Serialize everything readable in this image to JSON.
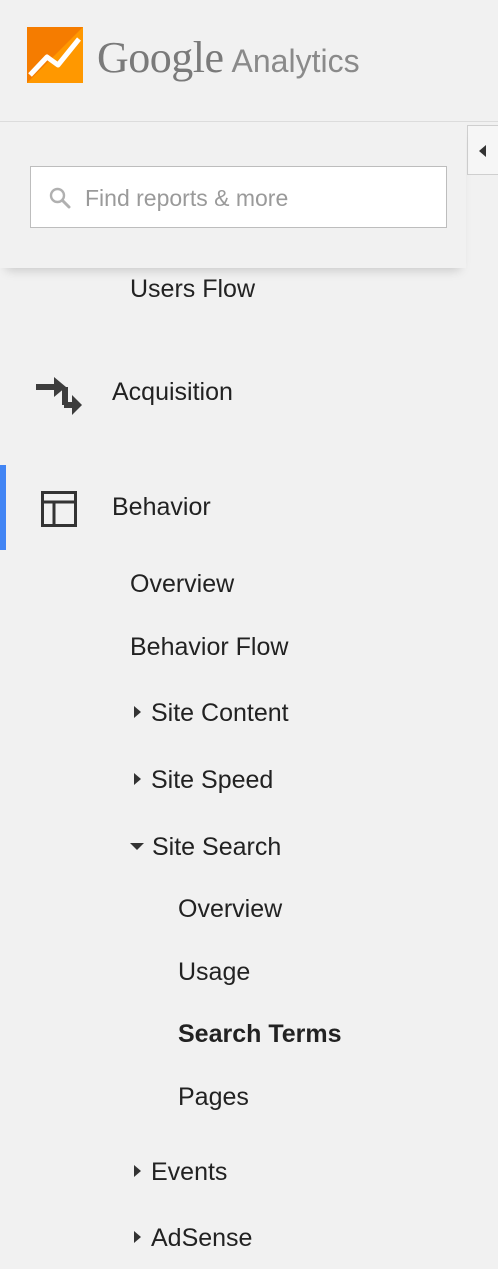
{
  "header": {
    "brand": "Google",
    "product": "Analytics",
    "logo_icon": "analytics-logo-icon",
    "logo_colors": [
      "#f57c00",
      "#ff9800",
      "#ffffff"
    ]
  },
  "collapse_button": {
    "icon": "triangle-left-icon"
  },
  "search": {
    "placeholder": "Find reports & more",
    "value": "",
    "icon": "search-icon"
  },
  "nav": {
    "users_flow": "Users Flow",
    "acquisition": {
      "label": "Acquisition",
      "icon": "acquisition-arrows-icon"
    },
    "behavior": {
      "label": "Behavior",
      "icon": "behavior-layout-icon",
      "active": true,
      "accent_color": "#4285f4",
      "items": {
        "overview": "Overview",
        "behavior_flow": "Behavior Flow",
        "site_content": "Site Content",
        "site_speed": "Site Speed",
        "site_search": {
          "label": "Site Search",
          "expanded": true,
          "items": {
            "overview": "Overview",
            "usage": "Usage",
            "search_terms": "Search Terms",
            "pages": "Pages"
          },
          "selected": "Search Terms"
        },
        "events": "Events",
        "adsense": "AdSense"
      }
    }
  }
}
